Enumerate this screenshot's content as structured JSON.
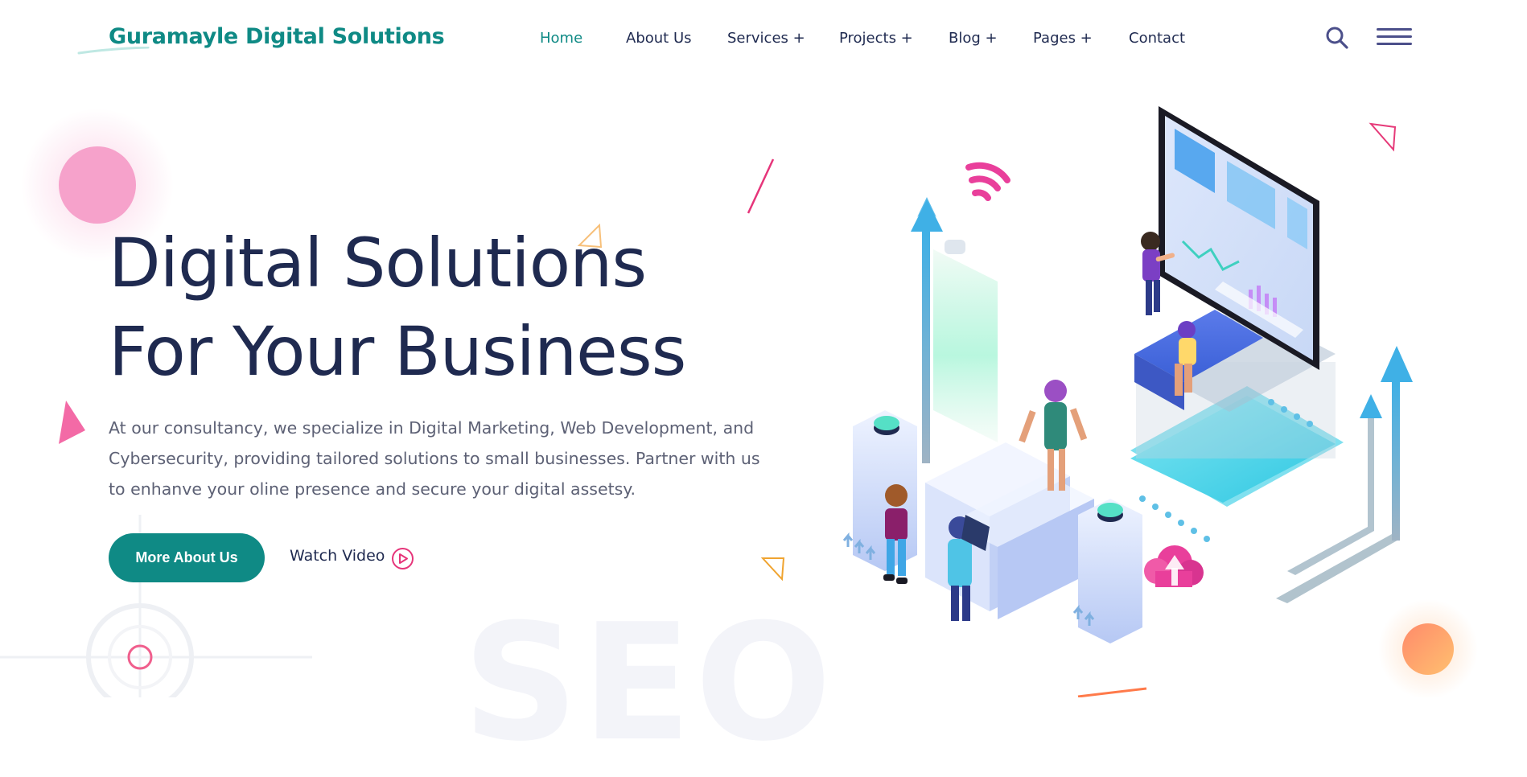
{
  "brand": {
    "name": "Guramayle Digital Solutions",
    "accent": "#0f8a85"
  },
  "nav": {
    "items": [
      {
        "label": "Home",
        "active": true
      },
      {
        "label": "About Us"
      },
      {
        "label": "Services +"
      },
      {
        "label": "Projects +"
      },
      {
        "label": "Blog +"
      },
      {
        "label": "Pages +"
      },
      {
        "label": "Contact"
      }
    ],
    "search_icon": "search-icon",
    "menu_icon": "hamburger-menu-icon"
  },
  "hero": {
    "title_line1": "Digital Solutions",
    "title_line2": "For Your Business",
    "description": "At our consultancy, we specialize in Digital Marketing, Web Development, and Cybersecurity, providing tailored solutions to small businesses. Partner with us to enhanve your oline presence and secure your digital assetsy.",
    "primary_button": "More About Us",
    "video_link": "Watch Video",
    "video_icon": "play-circle-icon",
    "background_text": "SEO"
  },
  "colors": {
    "heading": "#1f2a50",
    "body_text": "#5d6175",
    "pink": "#f06aa8",
    "orange": "#ff9a5a"
  }
}
